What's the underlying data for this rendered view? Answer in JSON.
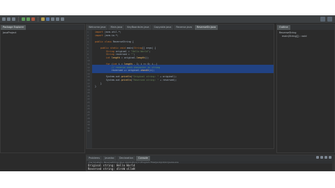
{
  "explorer": {
    "tab_label": "Package Explorer",
    "tree": [
      "JavaProject"
    ]
  },
  "editor": {
    "tabs": [
      "Welcome.java",
      "Main.java",
      "KeyBoardsim.java",
      "Copyable.java",
      "Reverse.java",
      "ReverseStr.java"
    ],
    "active_tab_index": 5,
    "line_numbers": [
      "1",
      "2",
      "3",
      "4",
      "5",
      "6",
      "7",
      "8",
      "9",
      "10",
      "11",
      "12",
      "13",
      "14",
      "15",
      "16",
      "17",
      "18",
      "19",
      "20",
      "21",
      "22",
      "23",
      "24",
      "25",
      "26",
      "27",
      "28",
      "29",
      "30",
      "31",
      "32"
    ],
    "code": [
      "  import java.util.*;",
      "  import java.io.*;",
      "",
      "  public class ReverseString {",
      "",
      "      public static void main(String[] args) {",
      "          String original = \"Hello World\";",
      "          String reversed = \"\";",
      "          int length = original.length();",
      "",
      "          for (int i = length - 1; i >= 0; i--)",
      "              // reverse each character in string",
      "              reversed += original.charAt(i);",
      "",
      "          System.out.println(\"Original string: \" + original);",
      "          System.out.println(\"Reversed string: \" + reversed);",
      "      }",
      "  }"
    ]
  },
  "outline": {
    "tab_label": "Outline",
    "items": [
      "ReverseString",
      "main(String[]) : void"
    ]
  },
  "console": {
    "tabs": [
      "Problems",
      "Javadoc",
      "Declaration",
      "Console"
    ],
    "active_tab_index": 3,
    "status": "<terminated> ReverseString [Java Application] C:\\Program Files\\Java\\jre\\bin\\javaw.exe",
    "output": [
      "Original string: Hello World",
      "Reversed string: dlroW olleH"
    ]
  }
}
